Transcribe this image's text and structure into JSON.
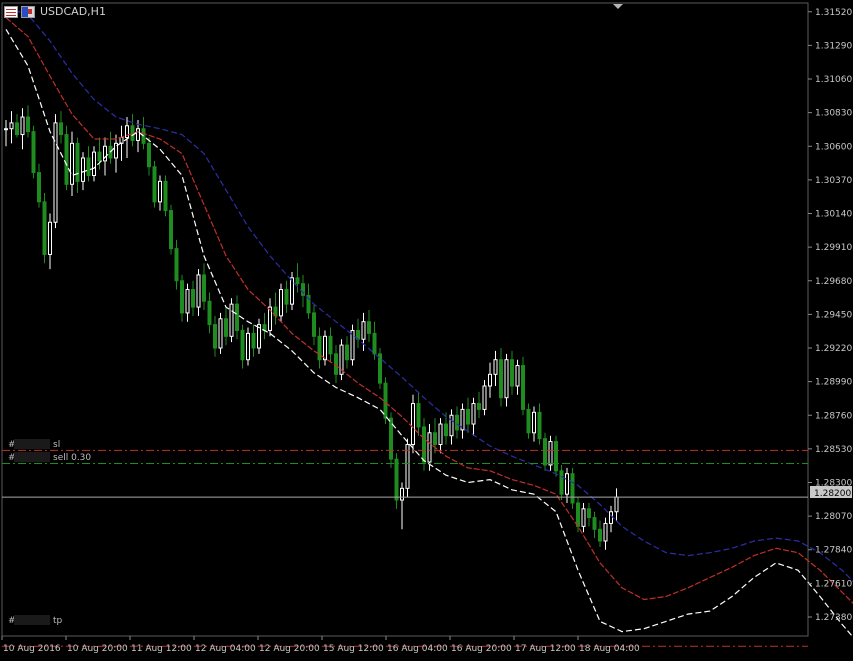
{
  "window": {
    "title": "USDCAD,H1"
  },
  "icons": {
    "list": "list-icon",
    "flag": "flag-icon",
    "scroll": "triangle-down-icon"
  },
  "colors": {
    "background": "#000000",
    "grid": "#1e1e1e",
    "bull_candle": "#ffffff",
    "bear_candle": "#1e8c1e",
    "ma_fast": "#ffffff",
    "ma_mid": "#c0302a",
    "ma_slow": "#2b2fa8",
    "sl_line": "#c0302a",
    "order_line": "#1e8c1e",
    "tp_line": "#c0302a",
    "current_price_line": "#a8a8a8",
    "price_box_bg": "#c8c8c8",
    "axis_text": "#c8c8c8"
  },
  "orders": {
    "sl_label": "#",
    "sl_suffix": "sl",
    "order_label": "#",
    "order_suffix": "sell 0.30",
    "tp_label": "#",
    "tp_suffix": "tp"
  },
  "price_axis": {
    "labels": [
      "1.31520",
      "1.31290",
      "1.31060",
      "1.30830",
      "1.30600",
      "1.30370",
      "1.30140",
      "1.29910",
      "1.29680",
      "1.29450",
      "1.29220",
      "1.28990",
      "1.28760",
      "1.28530",
      "1.28300",
      "1.28070",
      "1.27840",
      "1.27610",
      "1.27380"
    ],
    "current_price": "1.28200"
  },
  "time_axis": {
    "labels": [
      "10 Aug 2016",
      "10 Aug 20:00",
      "11 Aug 12:00",
      "12 Aug 04:00",
      "12 Aug 20:00",
      "15 Aug 12:00",
      "16 Aug 04:00",
      "16 Aug 20:00",
      "17 Aug 12:00",
      "18 Aug 04:00"
    ]
  },
  "chart_data": {
    "type": "candlestick",
    "title": "USDCAD,H1",
    "ylim": [
      1.2725,
      1.3158
    ],
    "current_price": 1.282,
    "levels": {
      "sl": 1.2852,
      "sell": 1.2843,
      "tp": 1.2718
    },
    "ma_fast": [
      [
        0,
        1.314
      ],
      [
        8,
        1.3115
      ],
      [
        16,
        1.307
      ],
      [
        24,
        1.304
      ],
      [
        32,
        1.3045
      ],
      [
        40,
        1.306
      ],
      [
        48,
        1.307
      ],
      [
        56,
        1.3058
      ],
      [
        64,
        1.304
      ],
      [
        72,
        1.2985
      ],
      [
        80,
        1.295
      ],
      [
        88,
        1.294
      ],
      [
        96,
        1.2932
      ],
      [
        104,
        1.292
      ],
      [
        112,
        1.2905
      ],
      [
        120,
        1.2895
      ],
      [
        128,
        1.2888
      ],
      [
        136,
        1.288
      ],
      [
        144,
        1.2862
      ],
      [
        152,
        1.2845
      ],
      [
        160,
        1.2835
      ],
      [
        168,
        1.283
      ],
      [
        176,
        1.2832
      ],
      [
        184,
        1.2825
      ],
      [
        192,
        1.2822
      ],
      [
        200,
        1.281
      ],
      [
        208,
        1.277
      ],
      [
        216,
        1.2735
      ],
      [
        224,
        1.2728
      ],
      [
        232,
        1.273
      ],
      [
        240,
        1.2735
      ],
      [
        248,
        1.274
      ],
      [
        256,
        1.2742
      ],
      [
        264,
        1.2752
      ],
      [
        272,
        1.2765
      ],
      [
        280,
        1.2775
      ],
      [
        288,
        1.277
      ],
      [
        296,
        1.2752
      ],
      [
        304,
        1.2733
      ],
      [
        310,
        1.272
      ]
    ],
    "ma_mid": [
      [
        0,
        1.3148
      ],
      [
        8,
        1.3135
      ],
      [
        16,
        1.3108
      ],
      [
        24,
        1.3082
      ],
      [
        32,
        1.3065
      ],
      [
        40,
        1.3065
      ],
      [
        48,
        1.307
      ],
      [
        56,
        1.3065
      ],
      [
        64,
        1.3055
      ],
      [
        72,
        1.302
      ],
      [
        80,
        1.2985
      ],
      [
        88,
        1.2962
      ],
      [
        96,
        1.2948
      ],
      [
        104,
        1.2932
      ],
      [
        112,
        1.292
      ],
      [
        120,
        1.291
      ],
      [
        128,
        1.2898
      ],
      [
        136,
        1.2888
      ],
      [
        144,
        1.2875
      ],
      [
        152,
        1.286
      ],
      [
        160,
        1.2848
      ],
      [
        168,
        1.284
      ],
      [
        176,
        1.2838
      ],
      [
        184,
        1.2832
      ],
      [
        192,
        1.2828
      ],
      [
        200,
        1.2822
      ],
      [
        208,
        1.28
      ],
      [
        216,
        1.2775
      ],
      [
        224,
        1.2758
      ],
      [
        232,
        1.275
      ],
      [
        240,
        1.2752
      ],
      [
        248,
        1.2758
      ],
      [
        256,
        1.2765
      ],
      [
        264,
        1.2772
      ],
      [
        272,
        1.278
      ],
      [
        280,
        1.2785
      ],
      [
        288,
        1.2782
      ],
      [
        296,
        1.277
      ],
      [
        304,
        1.2755
      ],
      [
        312,
        1.274
      ],
      [
        318,
        1.2732
      ]
    ],
    "ma_slow": [
      [
        0,
        1.3155
      ],
      [
        8,
        1.315
      ],
      [
        16,
        1.3132
      ],
      [
        24,
        1.311
      ],
      [
        32,
        1.3092
      ],
      [
        40,
        1.308
      ],
      [
        48,
        1.3075
      ],
      [
        56,
        1.3072
      ],
      [
        64,
        1.3068
      ],
      [
        72,
        1.3055
      ],
      [
        80,
        1.303
      ],
      [
        88,
        1.3005
      ],
      [
        96,
        1.2985
      ],
      [
        104,
        1.2968
      ],
      [
        112,
        1.2952
      ],
      [
        120,
        1.294
      ],
      [
        128,
        1.2928
      ],
      [
        136,
        1.2915
      ],
      [
        144,
        1.2902
      ],
      [
        152,
        1.2888
      ],
      [
        160,
        1.2875
      ],
      [
        168,
        1.2865
      ],
      [
        176,
        1.2855
      ],
      [
        184,
        1.2848
      ],
      [
        192,
        1.2842
      ],
      [
        200,
        1.2836
      ],
      [
        208,
        1.2828
      ],
      [
        216,
        1.2815
      ],
      [
        224,
        1.28
      ],
      [
        232,
        1.279
      ],
      [
        240,
        1.2782
      ],
      [
        248,
        1.278
      ],
      [
        256,
        1.2782
      ],
      [
        264,
        1.2785
      ],
      [
        272,
        1.279
      ],
      [
        280,
        1.2792
      ],
      [
        288,
        1.279
      ],
      [
        296,
        1.2782
      ],
      [
        304,
        1.277
      ],
      [
        312,
        1.2755
      ],
      [
        318,
        1.2745
      ]
    ],
    "candles": [
      [
        0,
        1.3072,
        1.3078,
        1.306,
        1.3072
      ],
      [
        2,
        1.3072,
        1.3084,
        1.3062,
        1.3076
      ],
      [
        4,
        1.3076,
        1.3082,
        1.3066,
        1.3068
      ],
      [
        6,
        1.3068,
        1.3086,
        1.3058,
        1.308
      ],
      [
        8,
        1.308,
        1.3088,
        1.3066,
        1.307
      ],
      [
        10,
        1.307,
        1.3074,
        1.3038,
        1.3042
      ],
      [
        12,
        1.3042,
        1.3048,
        1.3018,
        1.3022
      ],
      [
        14,
        1.3022,
        1.3028,
        1.298,
        1.2986
      ],
      [
        16,
        1.2986,
        1.3014,
        1.2976,
        1.3008
      ],
      [
        18,
        1.3008,
        1.3082,
        1.3004,
        1.3076
      ],
      [
        20,
        1.3076,
        1.3084,
        1.3062,
        1.3068
      ],
      [
        22,
        1.3068,
        1.3074,
        1.303,
        1.3034
      ],
      [
        24,
        1.3034,
        1.307,
        1.3026,
        1.3062
      ],
      [
        26,
        1.3062,
        1.3066,
        1.3028,
        1.3036
      ],
      [
        28,
        1.3036,
        1.3056,
        1.303,
        1.3052
      ],
      [
        30,
        1.3052,
        1.306,
        1.3036,
        1.304
      ],
      [
        32,
        1.304,
        1.306,
        1.3036,
        1.3056
      ],
      [
        34,
        1.3056,
        1.3066,
        1.3044,
        1.305
      ],
      [
        36,
        1.305,
        1.3066,
        1.304,
        1.306
      ],
      [
        38,
        1.306,
        1.307,
        1.3048,
        1.3052
      ],
      [
        40,
        1.3052,
        1.3068,
        1.3042,
        1.3062
      ],
      [
        42,
        1.3062,
        1.3074,
        1.305,
        1.3066
      ],
      [
        44,
        1.3066,
        1.308,
        1.3052,
        1.3074
      ],
      [
        46,
        1.3074,
        1.3082,
        1.306,
        1.3064
      ],
      [
        48,
        1.3064,
        1.3078,
        1.3056,
        1.3072
      ],
      [
        50,
        1.3072,
        1.308,
        1.3058,
        1.3062
      ],
      [
        52,
        1.3062,
        1.3066,
        1.304,
        1.3046
      ],
      [
        54,
        1.3046,
        1.305,
        1.3018,
        1.3022
      ],
      [
        56,
        1.3022,
        1.304,
        1.3016,
        1.3036
      ],
      [
        58,
        1.3036,
        1.304,
        1.3012,
        1.3016
      ],
      [
        60,
        1.3016,
        1.302,
        1.2986,
        1.299
      ],
      [
        62,
        1.299,
        1.2996,
        1.2962,
        1.2968
      ],
      [
        64,
        1.2968,
        1.2972,
        1.294,
        1.2946
      ],
      [
        66,
        1.2946,
        1.2966,
        1.294,
        1.2962
      ],
      [
        68,
        1.2962,
        1.2968,
        1.2944,
        1.295
      ],
      [
        70,
        1.295,
        1.2976,
        1.2944,
        1.2972
      ],
      [
        72,
        1.2972,
        1.298,
        1.2948,
        1.2954
      ],
      [
        74,
        1.2954,
        1.296,
        1.2932,
        1.2938
      ],
      [
        76,
        1.2938,
        1.2944,
        1.2916,
        1.2922
      ],
      [
        78,
        1.2922,
        1.2946,
        1.2918,
        1.2942
      ],
      [
        80,
        1.2942,
        1.295,
        1.2924,
        1.293
      ],
      [
        82,
        1.293,
        1.2956,
        1.2926,
        1.2952
      ],
      [
        84,
        1.2952,
        1.2958,
        1.2928,
        1.2934
      ],
      [
        86,
        1.2934,
        1.2938,
        1.2908,
        1.2914
      ],
      [
        88,
        1.2914,
        1.2936,
        1.291,
        1.2932
      ],
      [
        90,
        1.2932,
        1.2938,
        1.2916,
        1.2922
      ],
      [
        92,
        1.2922,
        1.2942,
        1.2918,
        1.2938
      ],
      [
        94,
        1.2938,
        1.2946,
        1.2928,
        1.2934
      ],
      [
        96,
        1.2934,
        1.2956,
        1.293,
        1.295
      ],
      [
        98,
        1.295,
        1.296,
        1.2938,
        1.2944
      ],
      [
        100,
        1.2944,
        1.2966,
        1.294,
        1.2962
      ],
      [
        102,
        1.2962,
        1.2968,
        1.2946,
        1.2952
      ],
      [
        104,
        1.2952,
        1.2974,
        1.2948,
        1.297
      ],
      [
        106,
        1.297,
        1.298,
        1.296,
        1.2966
      ],
      [
        108,
        1.2966,
        1.2972,
        1.295,
        1.2958
      ],
      [
        110,
        1.2958,
        1.2966,
        1.2942,
        1.2946
      ],
      [
        112,
        1.2946,
        1.2952,
        1.2924,
        1.293
      ],
      [
        114,
        1.293,
        1.2936,
        1.2908,
        1.2914
      ],
      [
        116,
        1.2914,
        1.2934,
        1.291,
        1.293
      ],
      [
        118,
        1.293,
        1.2936,
        1.2912,
        1.2918
      ],
      [
        120,
        1.2918,
        1.2924,
        1.2898,
        1.2904
      ],
      [
        122,
        1.2904,
        1.2928,
        1.29,
        1.2924
      ],
      [
        124,
        1.2924,
        1.293,
        1.2908,
        1.2914
      ],
      [
        126,
        1.2914,
        1.2938,
        1.291,
        1.2934
      ],
      [
        128,
        1.2934,
        1.2942,
        1.2922,
        1.2928
      ],
      [
        130,
        1.2928,
        1.2946,
        1.292,
        1.294
      ],
      [
        132,
        1.294,
        1.2948,
        1.2926,
        1.2932
      ],
      [
        134,
        1.2932,
        1.294,
        1.2914,
        1.2918
      ],
      [
        136,
        1.2918,
        1.2922,
        1.2894,
        1.2898
      ],
      [
        138,
        1.2898,
        1.2902,
        1.287,
        1.2874
      ],
      [
        140,
        1.2874,
        1.2878,
        1.284,
        1.2846
      ],
      [
        142,
        1.2846,
        1.285,
        1.2812,
        1.2818
      ],
      [
        144,
        1.2818,
        1.283,
        1.2798,
        1.2826
      ],
      [
        146,
        1.2826,
        1.286,
        1.282,
        1.2856
      ],
      [
        148,
        1.2856,
        1.289,
        1.285,
        1.2884
      ],
      [
        150,
        1.2884,
        1.2892,
        1.2862,
        1.2868
      ],
      [
        152,
        1.2868,
        1.2874,
        1.2838,
        1.2844
      ],
      [
        154,
        1.2844,
        1.287,
        1.2838,
        1.2864
      ],
      [
        156,
        1.2864,
        1.2874,
        1.285,
        1.2856
      ],
      [
        158,
        1.2856,
        1.2874,
        1.285,
        1.287
      ],
      [
        160,
        1.287,
        1.2878,
        1.2856,
        1.2862
      ],
      [
        162,
        1.2862,
        1.288,
        1.2856,
        1.2876
      ],
      [
        164,
        1.2876,
        1.2882,
        1.286,
        1.2866
      ],
      [
        166,
        1.2866,
        1.2884,
        1.286,
        1.288
      ],
      [
        168,
        1.288,
        1.2888,
        1.2864,
        1.287
      ],
      [
        170,
        1.287,
        1.2888,
        1.2862,
        1.2884
      ],
      [
        172,
        1.2884,
        1.2892,
        1.2874,
        1.288
      ],
      [
        174,
        1.288,
        1.29,
        1.2876,
        1.2896
      ],
      [
        176,
        1.2896,
        1.2912,
        1.2888,
        1.2904
      ],
      [
        178,
        1.2904,
        1.292,
        1.2896,
        1.2914
      ],
      [
        180,
        1.2914,
        1.2922,
        1.2882,
        1.2888
      ],
      [
        182,
        1.2888,
        1.2918,
        1.2882,
        1.2914
      ],
      [
        184,
        1.2914,
        1.292,
        1.289,
        1.2896
      ],
      [
        186,
        1.2896,
        1.2914,
        1.289,
        1.291
      ],
      [
        188,
        1.291,
        1.2916,
        1.2876,
        1.288
      ],
      [
        190,
        1.288,
        1.2884,
        1.286,
        1.2864
      ],
      [
        192,
        1.2864,
        1.2882,
        1.2858,
        1.2878
      ],
      [
        194,
        1.2878,
        1.2884,
        1.2856,
        1.286
      ],
      [
        196,
        1.286,
        1.2864,
        1.2838,
        1.2842
      ],
      [
        198,
        1.2842,
        1.2862,
        1.2838,
        1.2858
      ],
      [
        200,
        1.2858,
        1.2862,
        1.2834,
        1.2838
      ],
      [
        202,
        1.2838,
        1.2842,
        1.2818,
        1.2822
      ],
      [
        204,
        1.2822,
        1.284,
        1.2816,
        1.2836
      ],
      [
        206,
        1.2836,
        1.284,
        1.2812,
        1.2816
      ],
      [
        208,
        1.2816,
        1.282,
        1.2796,
        1.28
      ],
      [
        210,
        1.28,
        1.2816,
        1.2796,
        1.2812
      ],
      [
        212,
        1.2812,
        1.2816,
        1.28,
        1.2806
      ],
      [
        214,
        1.2806,
        1.281,
        1.2792,
        1.2798
      ],
      [
        216,
        1.2798,
        1.2804,
        1.2786,
        1.279
      ],
      [
        218,
        1.279,
        1.2806,
        1.2784,
        1.2802
      ],
      [
        220,
        1.2802,
        1.2814,
        1.2796,
        1.281
      ],
      [
        222,
        1.281,
        1.2826,
        1.2804,
        1.282
      ]
    ]
  }
}
